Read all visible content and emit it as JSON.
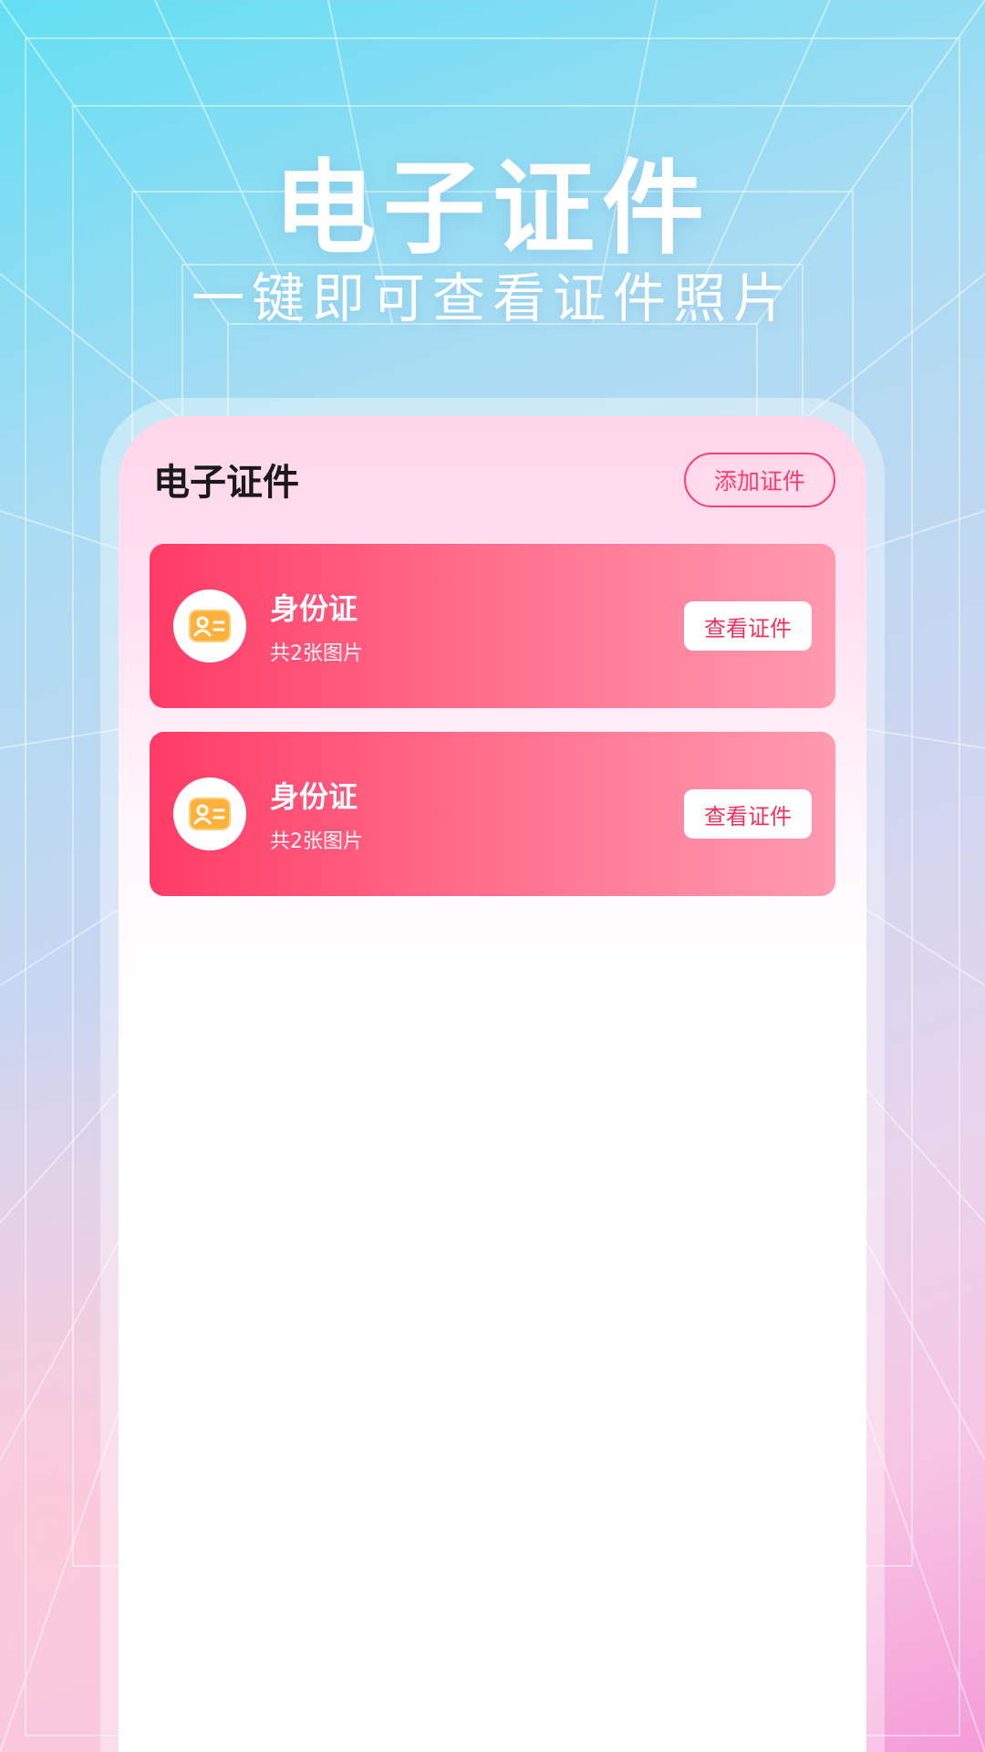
{
  "hero": {
    "title": "电子证件",
    "subtitle": "一键即可查看证件照片"
  },
  "panel": {
    "title": "电子证件",
    "add_button_label": "添加证件"
  },
  "cards": [
    {
      "icon": "id-card-icon",
      "title": "身份证",
      "subtitle": "共2张图片",
      "button_label": "查看证件"
    },
    {
      "icon": "id-card-icon",
      "title": "身份证",
      "subtitle": "共2张图片",
      "button_label": "查看证件"
    }
  ],
  "colors": {
    "accent": "#ff3d6b",
    "card_gradient_start": "#ff3b66",
    "card_gradient_end": "#ff9ab0",
    "icon_orange": "#ffb13b"
  }
}
